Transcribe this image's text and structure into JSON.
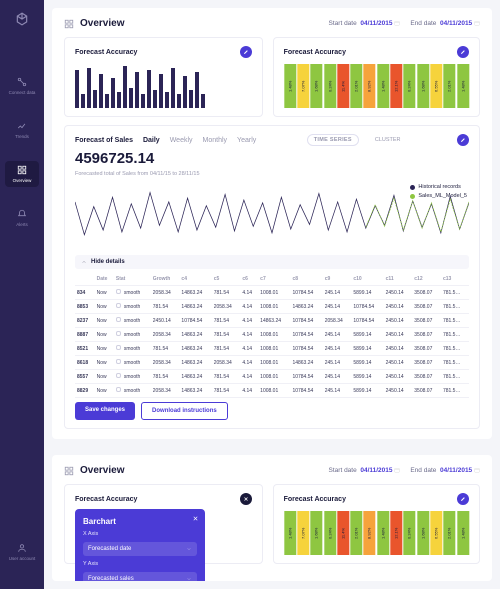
{
  "sidebar": {
    "items": [
      "Connect data",
      "Trends",
      "Overview",
      "Alerts"
    ],
    "bottom": "User account",
    "active": 2
  },
  "header": {
    "title": "Overview",
    "start_lbl": "Start date",
    "start_val": "04/11/2015",
    "end_lbl": "End date",
    "end_val": "04/11/2015"
  },
  "card_bar": {
    "title": "Forecast Accuracy"
  },
  "card_heat": {
    "title": "Forecast Accuracy"
  },
  "forecast": {
    "label": "Forecast of Sales",
    "tabs": [
      "Daily",
      "Weekly",
      "Monthly",
      "Yearly"
    ],
    "tab_active": 0,
    "ts": "TIME SERIES",
    "cluster": "CLUSTER",
    "big": "4596725.14",
    "sub": "Forecasted total of Sales from 04/11/15 to 28/11/15",
    "legend": [
      {
        "c": "#2b2456",
        "t": "Historical records"
      },
      {
        "c": "#8ec641",
        "t": "Sales_ML_Model_5"
      }
    ]
  },
  "details": {
    "toggle": "Hide details",
    "cols": [
      "",
      "Date",
      "Stat",
      "Growth",
      "c4",
      "c5",
      "c6",
      "c7",
      "c8",
      "c9",
      "c10",
      "c11",
      "c12",
      "c13"
    ],
    "rows": [
      [
        "834",
        "Now",
        "smooth",
        "2058.34",
        "14863.24",
        "781.54",
        "4.14",
        "1008.01",
        "10784.54",
        "245.14",
        "5899.14",
        "2450.14",
        "3508.07",
        "781.5…"
      ],
      [
        "8853",
        "Now",
        "smooth",
        "781.54",
        "14863.24",
        "2058.34",
        "4.14",
        "1008.01",
        "14863.24",
        "245.14",
        "10784.54",
        "2450.14",
        "3508.07",
        "781.5…"
      ],
      [
        "8237",
        "Now",
        "smooth",
        "2450.14",
        "10784.54",
        "781.54",
        "4.14",
        "14863.24",
        "10784.54",
        "2058.34",
        "10784.54",
        "2450.14",
        "3508.07",
        "781.5…"
      ],
      [
        "8887",
        "Now",
        "smooth",
        "2058.34",
        "14863.24",
        "781.54",
        "4.14",
        "1008.01",
        "10784.54",
        "245.14",
        "5899.14",
        "2450.14",
        "3508.07",
        "781.5…"
      ],
      [
        "8521",
        "Now",
        "smooth",
        "781.54",
        "14863.24",
        "781.54",
        "4.14",
        "1008.01",
        "10784.54",
        "245.14",
        "5899.14",
        "2450.14",
        "3508.07",
        "781.5…"
      ],
      [
        "8618",
        "Now",
        "smooth",
        "2058.34",
        "14863.24",
        "2058.34",
        "4.14",
        "1008.01",
        "14863.24",
        "245.14",
        "5899.14",
        "2450.14",
        "3508.07",
        "781.5…"
      ],
      [
        "8557",
        "Now",
        "smooth",
        "781.54",
        "14863.24",
        "781.54",
        "4.14",
        "1008.01",
        "10784.54",
        "245.14",
        "5899.14",
        "2450.14",
        "3508.07",
        "781.5…"
      ],
      [
        "8829",
        "Now",
        "smooth",
        "2058.34",
        "14863.24",
        "781.54",
        "4.14",
        "1008.01",
        "10784.54",
        "245.14",
        "5899.14",
        "2450.14",
        "3508.07",
        "781.5…"
      ]
    ]
  },
  "buttons": {
    "save": "Save changes",
    "download": "Download instructions"
  },
  "popup": {
    "title": "Barchart",
    "xlbl": "X Axis",
    "xval": "Forecasted date",
    "ylbl": "Y Axis",
    "yval": "Forecasted sales"
  },
  "chart_data": {
    "bar": {
      "type": "bar",
      "values": [
        38,
        14,
        40,
        18,
        34,
        14,
        30,
        16,
        42,
        20,
        36,
        14,
        38,
        18,
        34,
        16,
        40,
        14,
        32,
        18,
        36,
        14
      ]
    },
    "heat": {
      "type": "heatmap",
      "cells": [
        {
          "c": "#8ec641",
          "v": "1.48%"
        },
        {
          "c": "#f6d33c",
          "v": "7.07%"
        },
        {
          "c": "#8ec641",
          "v": "1.68%"
        },
        {
          "c": "#8ec641",
          "v": "0.24%"
        },
        {
          "c": "#e9552c",
          "v": "11.4%"
        },
        {
          "c": "#8ec641",
          "v": "2.01%"
        },
        {
          "c": "#f6a33c",
          "v": "8.92%"
        },
        {
          "c": "#8ec641",
          "v": "1.48%"
        },
        {
          "c": "#e9552c",
          "v": "12.1%"
        },
        {
          "c": "#8ec641",
          "v": "0.24%"
        },
        {
          "c": "#8ec641",
          "v": "1.68%"
        },
        {
          "c": "#f6d33c",
          "v": "6.55%"
        },
        {
          "c": "#8ec641",
          "v": "2.01%"
        },
        {
          "c": "#8ec641",
          "v": "1.48%"
        }
      ]
    },
    "line": {
      "type": "line",
      "series": [
        {
          "name": "Historical records",
          "color": "#2b2456",
          "values": [
            50,
            15,
            45,
            20,
            55,
            18,
            48,
            22,
            60,
            25,
            50,
            18,
            54,
            20,
            46,
            23,
            58,
            19,
            52,
            24,
            49,
            17,
            55,
            21,
            47,
            26,
            59,
            20,
            50,
            18,
            53,
            22,
            46,
            25,
            57,
            19,
            51,
            23,
            48,
            17,
            56,
            21,
            49
          ]
        },
        {
          "name": "Sales_ML_Model_5",
          "color": "#8ec641",
          "values": [
            52,
            18,
            48,
            22,
            53,
            20,
            49,
            23,
            55,
            24,
            50,
            19,
            52,
            22,
            48,
            24,
            54,
            20,
            51,
            23,
            49,
            19,
            53,
            21,
            48,
            25,
            55,
            21,
            50,
            19,
            52,
            23,
            47,
            24,
            54,
            20,
            51,
            22,
            49,
            18,
            53,
            21,
            50
          ]
        }
      ]
    }
  }
}
